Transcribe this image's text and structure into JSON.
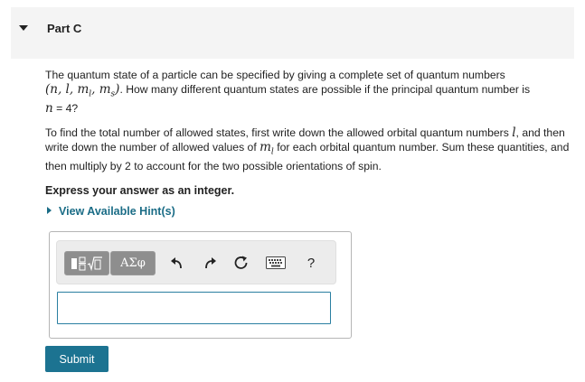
{
  "part": {
    "title": "Part C"
  },
  "question": {
    "p1_before": "The quantum state of a particle can be specified by giving a complete set of quantum numbers",
    "p1_math": "(n, l, m",
    "p1_sub_l": "l",
    "p1_math_mid": ", m",
    "p1_sub_s": "s",
    "p1_math_end": ")",
    "p1_after": ". How many different quantum states are possible if the principal quantum number is",
    "p1_n": "n",
    "p1_n_value": " = 4?",
    "p2_text1": "To find the total number of allowed states, first write down the allowed orbital quantum numbers ",
    "p2_l": "l",
    "p2_text2": ", and then write down the number of allowed values of ",
    "p2_ml": "m",
    "p2_ml_sub": "l",
    "p2_text3": " for each orbital quantum number. Sum these quantities, and then multiply by 2 to account for the two possible orientations of spin.",
    "express": "Express your answer as an integer."
  },
  "hints": {
    "label": "View Available Hint(s)"
  },
  "toolbar": {
    "greek_label": "ΑΣφ",
    "help_label": "?",
    "icons": [
      "templates-icon",
      "greek-symbols-icon",
      "undo-icon",
      "redo-icon",
      "reset-icon",
      "keyboard-icon",
      "help-icon"
    ]
  },
  "answer": {
    "value": "",
    "placeholder": ""
  },
  "submit": {
    "label": "Submit"
  },
  "colors": {
    "accent": "#1c7391",
    "link": "#1a6c86",
    "toolbar_button": "#8e8e8e"
  }
}
